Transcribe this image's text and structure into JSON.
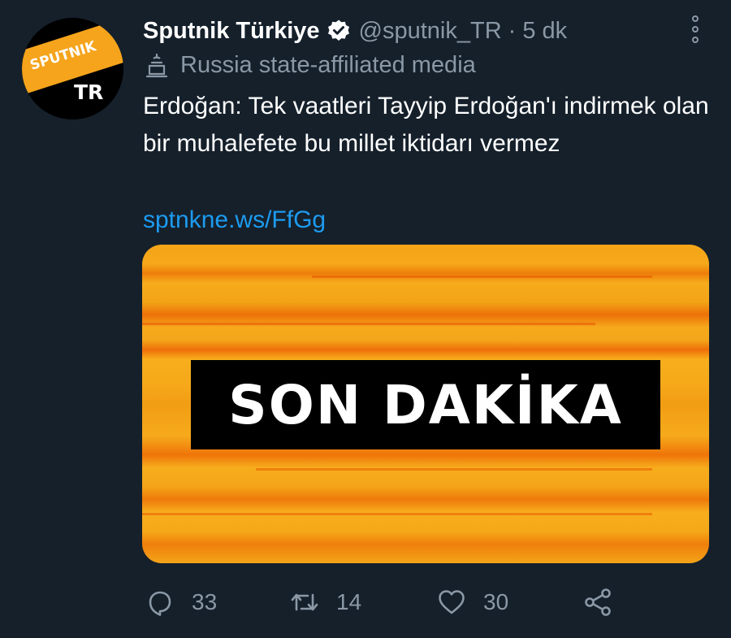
{
  "author": {
    "display_name": "Sputnik Türkiye",
    "handle": "@sputnik_TR",
    "separator": "·",
    "time": "5 dk",
    "avatar_brand_text": "SPUTNIK",
    "avatar_region_text": "TR"
  },
  "affiliation": {
    "label": "Russia state-affiliated media",
    "icon": "government-building-icon"
  },
  "tweet": {
    "text": "Erdoğan: Tek vaatleri Tayyip Erdoğan'ı indirmek olan bir muhalefete bu millet iktidarı vermez",
    "link": "sptnkne.ws/FfGg"
  },
  "media": {
    "banner_text": "SON DAKİKA",
    "background_color": "#f5a61a",
    "banner_color": "#000000"
  },
  "actions": {
    "reply_count": "33",
    "retweet_count": "14",
    "like_count": "30"
  },
  "colors": {
    "background": "#15202b",
    "secondary_text": "#8b98a5",
    "link": "#1d9bf0",
    "avatar_orange": "#f5a41c"
  }
}
